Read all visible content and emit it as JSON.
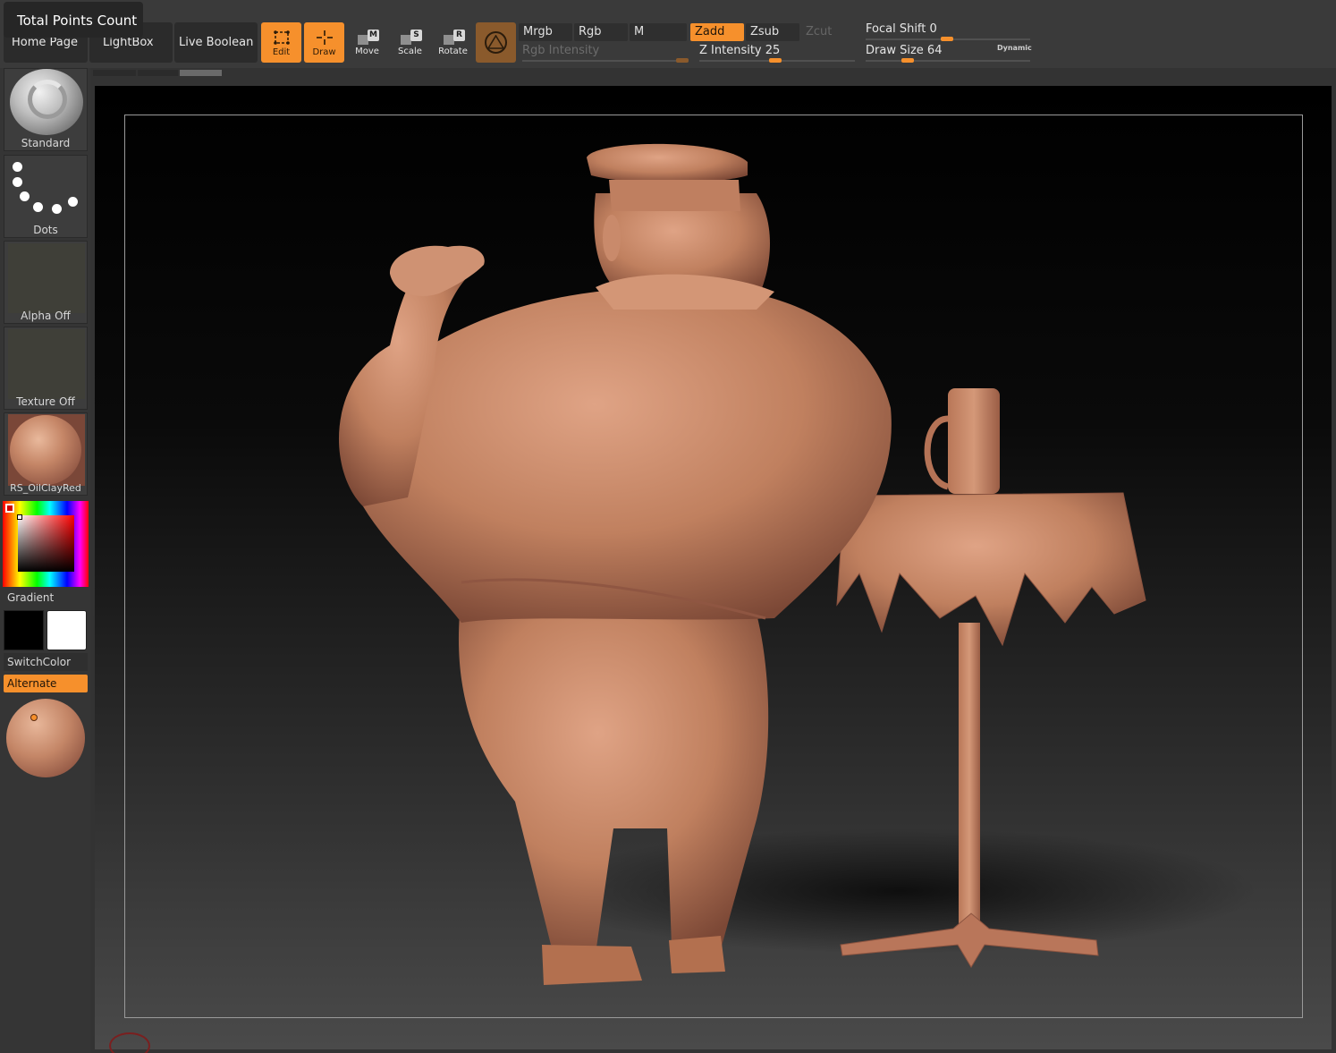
{
  "tooltip": {
    "text": "Total Points Count"
  },
  "nav": {
    "home_page": "Home Page",
    "lightbox": "LightBox",
    "live_boolean": "Live Boolean"
  },
  "tools": {
    "edit": {
      "label": "Edit",
      "active": true
    },
    "draw": {
      "label": "Draw",
      "active": true
    },
    "move": {
      "label": "Move",
      "key": "M"
    },
    "scale": {
      "label": "Scale",
      "key": "S"
    },
    "rotate": {
      "label": "Rotate",
      "key": "R"
    }
  },
  "channels": {
    "mrgb": "Mrgb",
    "rgb": "Rgb",
    "m": "M",
    "zadd": "Zadd",
    "zsub": "Zsub",
    "zcut": "Zcut",
    "rgb_intensity": "Rgb Intensity",
    "z_intensity_label": "Z Intensity",
    "z_intensity_value": "25",
    "focal_shift_label": "Focal Shift",
    "focal_shift_value": "0",
    "draw_size_label": "Draw Size",
    "draw_size_value": "64",
    "dynamic": "Dynamic"
  },
  "shelf": {
    "brush": "Standard",
    "stroke": "Dots",
    "alpha": "Alpha Off",
    "texture": "Texture Off",
    "material": "RS_OilClayRed",
    "gradient": "Gradient",
    "switch_color": "SwitchColor",
    "alternate": "Alternate"
  },
  "colors": {
    "accent": "#f6902c",
    "main_color": "#000000",
    "secondary_color": "#ffffff",
    "clay": "#c58667"
  }
}
